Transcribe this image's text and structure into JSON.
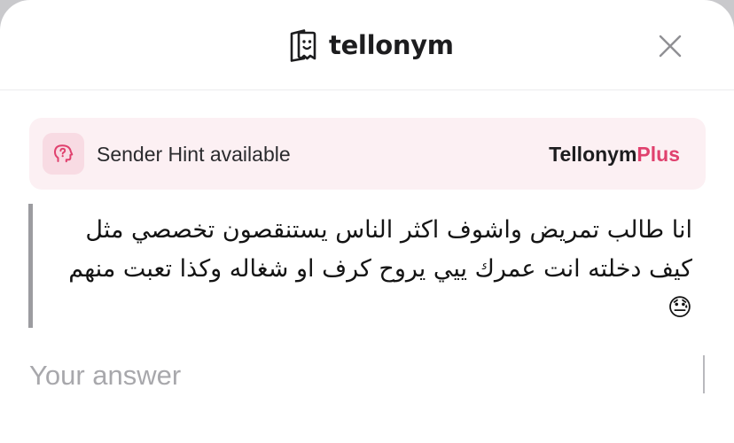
{
  "app": {
    "name": "tellonym",
    "logo_icon": "tellonym-logo-icon",
    "close_icon": "close-icon"
  },
  "hint_banner": {
    "icon": "sender-hint-icon",
    "text": "Sender Hint available",
    "plus_label_part1": "Tellonym",
    "plus_label_part2": "Plus",
    "plus_color": "#e0416e",
    "background": "#fcf0f3"
  },
  "question": {
    "text": "انا طالب تمريض واشوف اكثر الناس يستنقصون تخصصي مثل كيف دخلته انت عمرك ييي يروح كرف او شغاله وكذا تعبت منهم😓"
  },
  "answer": {
    "placeholder": "Your answer",
    "value": ""
  }
}
